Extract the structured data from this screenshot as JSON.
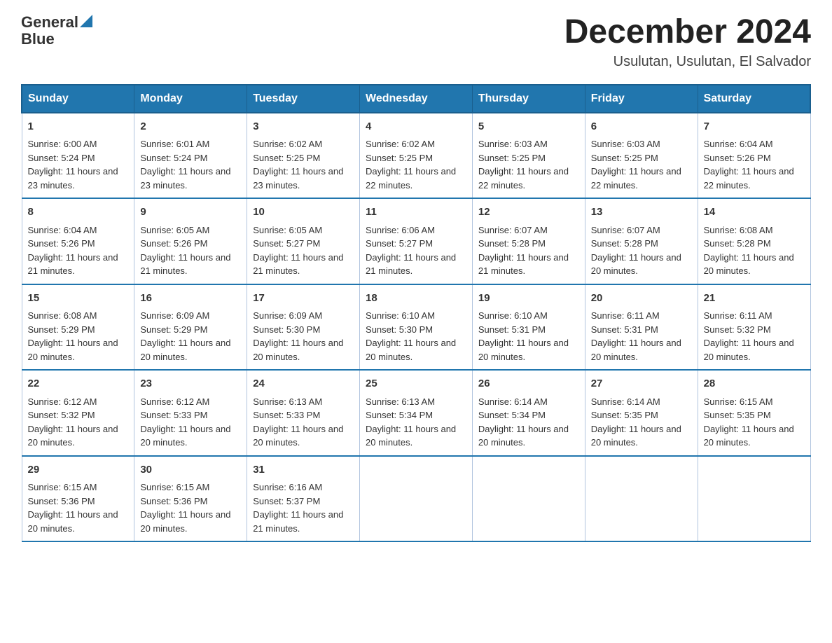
{
  "logo": {
    "name_part1": "General",
    "name_part2": "Blue"
  },
  "calendar": {
    "title": "December 2024",
    "subtitle": "Usulutan, Usulutan, El Salvador",
    "days_of_week": [
      "Sunday",
      "Monday",
      "Tuesday",
      "Wednesday",
      "Thursday",
      "Friday",
      "Saturday"
    ],
    "weeks": [
      [
        {
          "day": "1",
          "sunrise": "6:00 AM",
          "sunset": "5:24 PM",
          "daylight": "11 hours and 23 minutes."
        },
        {
          "day": "2",
          "sunrise": "6:01 AM",
          "sunset": "5:24 PM",
          "daylight": "11 hours and 23 minutes."
        },
        {
          "day": "3",
          "sunrise": "6:02 AM",
          "sunset": "5:25 PM",
          "daylight": "11 hours and 23 minutes."
        },
        {
          "day": "4",
          "sunrise": "6:02 AM",
          "sunset": "5:25 PM",
          "daylight": "11 hours and 22 minutes."
        },
        {
          "day": "5",
          "sunrise": "6:03 AM",
          "sunset": "5:25 PM",
          "daylight": "11 hours and 22 minutes."
        },
        {
          "day": "6",
          "sunrise": "6:03 AM",
          "sunset": "5:25 PM",
          "daylight": "11 hours and 22 minutes."
        },
        {
          "day": "7",
          "sunrise": "6:04 AM",
          "sunset": "5:26 PM",
          "daylight": "11 hours and 22 minutes."
        }
      ],
      [
        {
          "day": "8",
          "sunrise": "6:04 AM",
          "sunset": "5:26 PM",
          "daylight": "11 hours and 21 minutes."
        },
        {
          "day": "9",
          "sunrise": "6:05 AM",
          "sunset": "5:26 PM",
          "daylight": "11 hours and 21 minutes."
        },
        {
          "day": "10",
          "sunrise": "6:05 AM",
          "sunset": "5:27 PM",
          "daylight": "11 hours and 21 minutes."
        },
        {
          "day": "11",
          "sunrise": "6:06 AM",
          "sunset": "5:27 PM",
          "daylight": "11 hours and 21 minutes."
        },
        {
          "day": "12",
          "sunrise": "6:07 AM",
          "sunset": "5:28 PM",
          "daylight": "11 hours and 21 minutes."
        },
        {
          "day": "13",
          "sunrise": "6:07 AM",
          "sunset": "5:28 PM",
          "daylight": "11 hours and 20 minutes."
        },
        {
          "day": "14",
          "sunrise": "6:08 AM",
          "sunset": "5:28 PM",
          "daylight": "11 hours and 20 minutes."
        }
      ],
      [
        {
          "day": "15",
          "sunrise": "6:08 AM",
          "sunset": "5:29 PM",
          "daylight": "11 hours and 20 minutes."
        },
        {
          "day": "16",
          "sunrise": "6:09 AM",
          "sunset": "5:29 PM",
          "daylight": "11 hours and 20 minutes."
        },
        {
          "day": "17",
          "sunrise": "6:09 AM",
          "sunset": "5:30 PM",
          "daylight": "11 hours and 20 minutes."
        },
        {
          "day": "18",
          "sunrise": "6:10 AM",
          "sunset": "5:30 PM",
          "daylight": "11 hours and 20 minutes."
        },
        {
          "day": "19",
          "sunrise": "6:10 AM",
          "sunset": "5:31 PM",
          "daylight": "11 hours and 20 minutes."
        },
        {
          "day": "20",
          "sunrise": "6:11 AM",
          "sunset": "5:31 PM",
          "daylight": "11 hours and 20 minutes."
        },
        {
          "day": "21",
          "sunrise": "6:11 AM",
          "sunset": "5:32 PM",
          "daylight": "11 hours and 20 minutes."
        }
      ],
      [
        {
          "day": "22",
          "sunrise": "6:12 AM",
          "sunset": "5:32 PM",
          "daylight": "11 hours and 20 minutes."
        },
        {
          "day": "23",
          "sunrise": "6:12 AM",
          "sunset": "5:33 PM",
          "daylight": "11 hours and 20 minutes."
        },
        {
          "day": "24",
          "sunrise": "6:13 AM",
          "sunset": "5:33 PM",
          "daylight": "11 hours and 20 minutes."
        },
        {
          "day": "25",
          "sunrise": "6:13 AM",
          "sunset": "5:34 PM",
          "daylight": "11 hours and 20 minutes."
        },
        {
          "day": "26",
          "sunrise": "6:14 AM",
          "sunset": "5:34 PM",
          "daylight": "11 hours and 20 minutes."
        },
        {
          "day": "27",
          "sunrise": "6:14 AM",
          "sunset": "5:35 PM",
          "daylight": "11 hours and 20 minutes."
        },
        {
          "day": "28",
          "sunrise": "6:15 AM",
          "sunset": "5:35 PM",
          "daylight": "11 hours and 20 minutes."
        }
      ],
      [
        {
          "day": "29",
          "sunrise": "6:15 AM",
          "sunset": "5:36 PM",
          "daylight": "11 hours and 20 minutes."
        },
        {
          "day": "30",
          "sunrise": "6:15 AM",
          "sunset": "5:36 PM",
          "daylight": "11 hours and 20 minutes."
        },
        {
          "day": "31",
          "sunrise": "6:16 AM",
          "sunset": "5:37 PM",
          "daylight": "11 hours and 21 minutes."
        },
        null,
        null,
        null,
        null
      ]
    ]
  }
}
